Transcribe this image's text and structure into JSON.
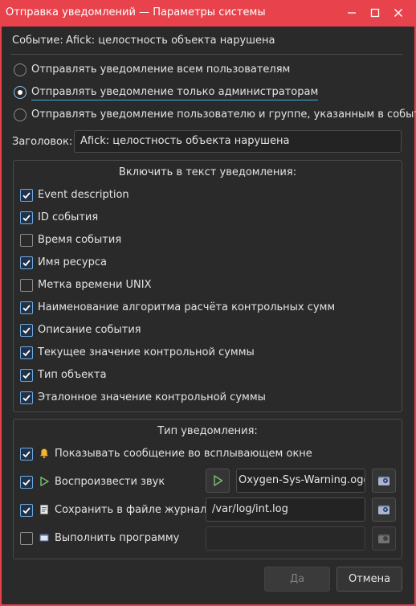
{
  "window": {
    "title": "Отправка уведомлений — Параметры системы"
  },
  "event": {
    "label": "Событие:",
    "name": "Afick: целостность объекта нарушена"
  },
  "recipients": {
    "options": [
      {
        "label": "Отправлять уведомление всем пользователям",
        "selected": false
      },
      {
        "label": "Отправлять уведомление только администраторам",
        "selected": true
      },
      {
        "label": "Отправлять уведомление пользователю и группе, указанным в событии",
        "selected": false
      }
    ]
  },
  "header_field": {
    "label": "Заголовок:",
    "value": "Afick: целостность объекта нарушена"
  },
  "include_group": {
    "title": "Включить в текст уведомления:",
    "items": [
      {
        "label": "Event description",
        "checked": true
      },
      {
        "label": "ID события",
        "checked": true
      },
      {
        "label": "Время события",
        "checked": false
      },
      {
        "label": "Имя ресурса",
        "checked": true
      },
      {
        "label": "Метка времени UNIX",
        "checked": false
      },
      {
        "label": "Наименование алгоритма расчёта контрольных сумм",
        "checked": true
      },
      {
        "label": "Описание события",
        "checked": true
      },
      {
        "label": "Текущее значение контрольной суммы",
        "checked": true
      },
      {
        "label": "Тип объекта",
        "checked": true
      },
      {
        "label": "Эталонное значение контрольной суммы",
        "checked": true
      }
    ]
  },
  "type_group": {
    "title": "Тип уведомления:",
    "popup": {
      "label": "Показывать сообщение во всплывающем окне",
      "checked": true,
      "icon": "bell-icon"
    },
    "sound": {
      "label": "Воспроизвести звук",
      "checked": true,
      "icon": "play-icon",
      "file": "Oxygen-Sys-Warning.ogg"
    },
    "log": {
      "label": "Сохранить в файле журнала",
      "checked": true,
      "icon": "document-icon",
      "file": "/var/log/int.log"
    },
    "program": {
      "label": "Выполнить программу",
      "checked": false,
      "icon": "terminal-icon",
      "file": ""
    }
  },
  "buttons": {
    "yes": "Да",
    "cancel": "Отмена"
  },
  "colors": {
    "titlebar": "#e8434c",
    "background": "#2a2a2a",
    "accent": "#3daee9"
  }
}
